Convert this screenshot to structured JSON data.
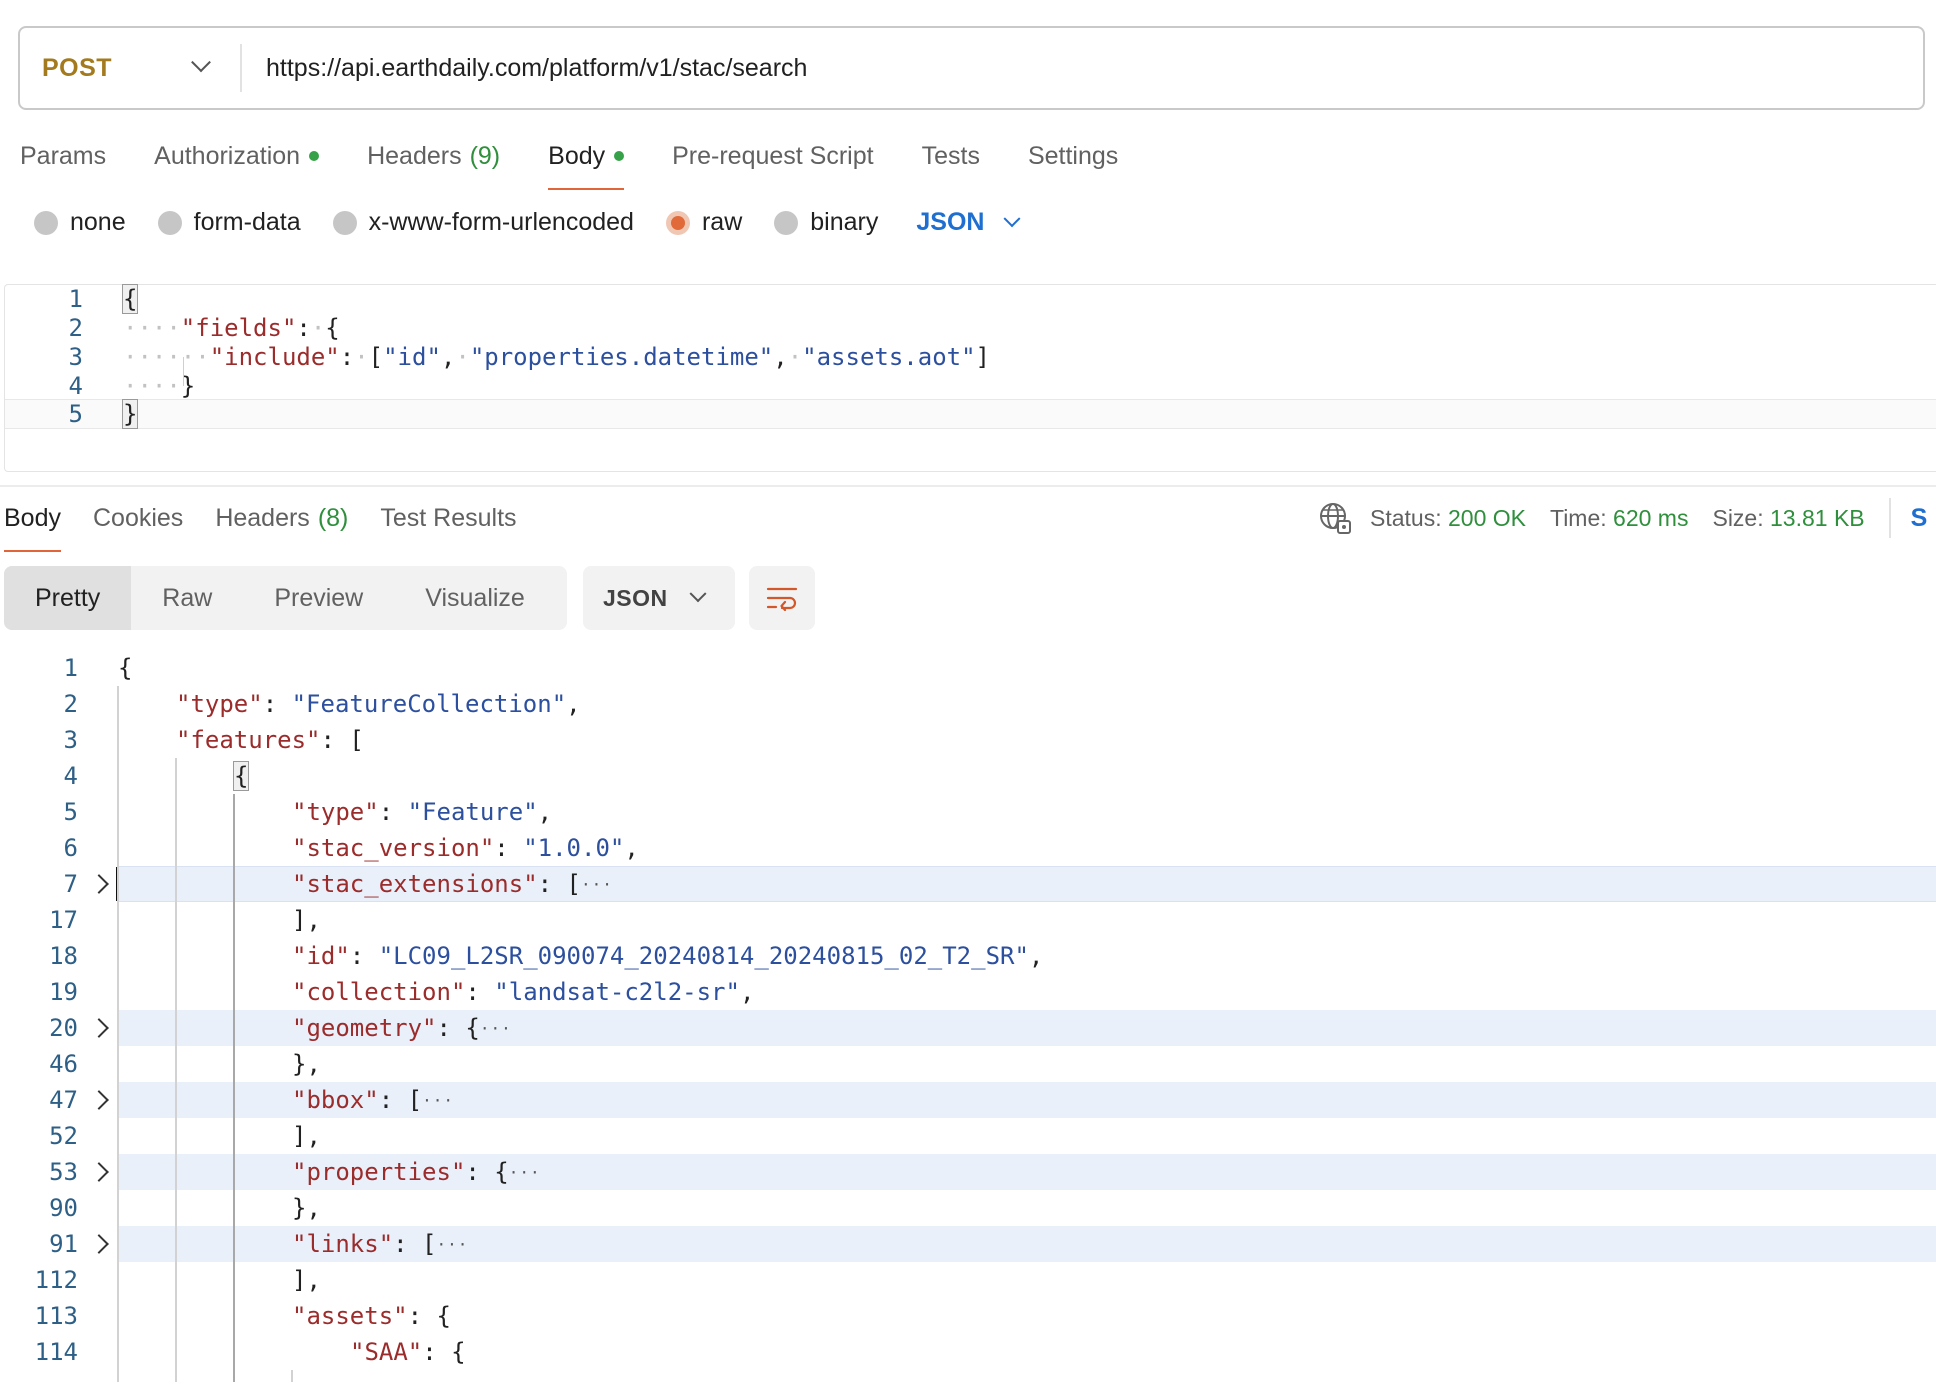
{
  "request": {
    "method": "POST",
    "url": "https://api.earthdaily.com/platform/v1/stac/search"
  },
  "request_tabs": [
    {
      "label": "Params",
      "count": "",
      "dot": false,
      "active": false
    },
    {
      "label": "Authorization",
      "count": "",
      "dot": true,
      "active": false
    },
    {
      "label": "Headers",
      "count": "(9)",
      "dot": false,
      "active": false
    },
    {
      "label": "Body",
      "count": "",
      "dot": true,
      "active": true
    },
    {
      "label": "Pre-request Script",
      "count": "",
      "dot": false,
      "active": false
    },
    {
      "label": "Tests",
      "count": "",
      "dot": false,
      "active": false
    },
    {
      "label": "Settings",
      "count": "",
      "dot": false,
      "active": false
    }
  ],
  "body_types": [
    {
      "label": "none",
      "selected": false
    },
    {
      "label": "form-data",
      "selected": false
    },
    {
      "label": "x-www-form-urlencoded",
      "selected": false
    },
    {
      "label": "raw",
      "selected": true
    },
    {
      "label": "binary",
      "selected": false
    }
  ],
  "body_format": "JSON",
  "request_body_lines": [
    {
      "n": "1",
      "tokens": [
        {
          "t": "{",
          "c": "p"
        }
      ]
    },
    {
      "n": "2",
      "tokens": [
        {
          "t": "····",
          "c": "ws"
        },
        {
          "t": "\"fields\"",
          "c": "k"
        },
        {
          "t": ":",
          "c": "p"
        },
        {
          "t": "·",
          "c": "ws"
        },
        {
          "t": "{",
          "c": "p"
        }
      ]
    },
    {
      "n": "3",
      "tokens": [
        {
          "t": "····",
          "c": "ws"
        },
        {
          "t": "··",
          "c": "ws"
        },
        {
          "t": "\"include\"",
          "c": "k"
        },
        {
          "t": ":",
          "c": "p"
        },
        {
          "t": "·",
          "c": "ws"
        },
        {
          "t": "[",
          "c": "p"
        },
        {
          "t": "\"id\"",
          "c": "s"
        },
        {
          "t": ",",
          "c": "p"
        },
        {
          "t": "·",
          "c": "ws"
        },
        {
          "t": "\"properties.datetime\"",
          "c": "s"
        },
        {
          "t": ",",
          "c": "p"
        },
        {
          "t": "·",
          "c": "ws"
        },
        {
          "t": "\"assets.aot\"",
          "c": "s"
        },
        {
          "t": "]",
          "c": "p"
        }
      ]
    },
    {
      "n": "4",
      "tokens": [
        {
          "t": "····",
          "c": "ws"
        },
        {
          "t": "}",
          "c": "p"
        }
      ]
    },
    {
      "n": "5",
      "tokens": [
        {
          "t": "}",
          "c": "p"
        }
      ]
    }
  ],
  "response_tabs": [
    {
      "label": "Body",
      "count": "",
      "active": true
    },
    {
      "label": "Cookies",
      "count": "",
      "active": false
    },
    {
      "label": "Headers",
      "count": "(8)",
      "active": false
    },
    {
      "label": "Test Results",
      "count": "",
      "active": false
    }
  ],
  "response_status": {
    "status_label": "Status:",
    "status_value": "200 OK",
    "time_label": "Time:",
    "time_value": "620 ms",
    "size_label": "Size:",
    "size_value": "13.81 KB",
    "save_label": "S"
  },
  "view_modes": [
    "Pretty",
    "Raw",
    "Preview",
    "Visualize"
  ],
  "active_view_mode": "Pretty",
  "response_format": "JSON",
  "icons": {
    "globe": "globe-network-icon",
    "wrap": "word-wrap-icon",
    "fold": "chevron-right-icon"
  },
  "colors": {
    "method": "#a37a1e",
    "accent": "#e0663a",
    "success": "#2f8f3d",
    "link": "#1f6fd1",
    "json_key": "#9b2c2c",
    "json_string": "#2c4f9e"
  },
  "response_body_lines": [
    {
      "n": "1",
      "indent": 0,
      "tokens": [
        {
          "t": "{",
          "c": "p"
        }
      ]
    },
    {
      "n": "2",
      "indent": 1,
      "tokens": [
        {
          "t": "\"type\"",
          "c": "k"
        },
        {
          "t": ": ",
          "c": "p"
        },
        {
          "t": "\"FeatureCollection\"",
          "c": "s"
        },
        {
          "t": ",",
          "c": "p"
        }
      ]
    },
    {
      "n": "3",
      "indent": 1,
      "tokens": [
        {
          "t": "\"features\"",
          "c": "k"
        },
        {
          "t": ": [",
          "c": "p"
        }
      ]
    },
    {
      "n": "4",
      "indent": 2,
      "tokens": [
        {
          "t": "{",
          "c": "p",
          "box": true
        }
      ]
    },
    {
      "n": "5",
      "indent": 3,
      "tokens": [
        {
          "t": "\"type\"",
          "c": "k"
        },
        {
          "t": ": ",
          "c": "p"
        },
        {
          "t": "\"Feature\"",
          "c": "s"
        },
        {
          "t": ",",
          "c": "p"
        }
      ]
    },
    {
      "n": "6",
      "indent": 3,
      "tokens": [
        {
          "t": "\"stac_version\"",
          "c": "k"
        },
        {
          "t": ": ",
          "c": "p"
        },
        {
          "t": "\"1.0.0\"",
          "c": "s"
        },
        {
          "t": ",",
          "c": "p"
        }
      ]
    },
    {
      "n": "7",
      "indent": 3,
      "fold": true,
      "hl": true,
      "cursor": true,
      "tokens": [
        {
          "t": "\"stac_extensions\"",
          "c": "k"
        },
        {
          "t": ": [",
          "c": "p"
        },
        {
          "t": "···",
          "c": "ell"
        }
      ]
    },
    {
      "n": "17",
      "indent": 3,
      "tokens": [
        {
          "t": "],",
          "c": "p"
        }
      ]
    },
    {
      "n": "18",
      "indent": 3,
      "tokens": [
        {
          "t": "\"id\"",
          "c": "k"
        },
        {
          "t": ": ",
          "c": "p"
        },
        {
          "t": "\"LC09_L2SR_090074_20240814_20240815_02_T2_SR\"",
          "c": "s"
        },
        {
          "t": ",",
          "c": "p"
        }
      ]
    },
    {
      "n": "19",
      "indent": 3,
      "tokens": [
        {
          "t": "\"collection\"",
          "c": "k"
        },
        {
          "t": ": ",
          "c": "p"
        },
        {
          "t": "\"landsat-c2l2-sr\"",
          "c": "s"
        },
        {
          "t": ",",
          "c": "p"
        }
      ]
    },
    {
      "n": "20",
      "indent": 3,
      "fold": true,
      "hl": true,
      "tokens": [
        {
          "t": "\"geometry\"",
          "c": "k"
        },
        {
          "t": ": {",
          "c": "p"
        },
        {
          "t": "···",
          "c": "ell"
        }
      ]
    },
    {
      "n": "46",
      "indent": 3,
      "tokens": [
        {
          "t": "},",
          "c": "p"
        }
      ]
    },
    {
      "n": "47",
      "indent": 3,
      "fold": true,
      "hl": true,
      "tokens": [
        {
          "t": "\"bbox\"",
          "c": "k"
        },
        {
          "t": ": [",
          "c": "p"
        },
        {
          "t": "···",
          "c": "ell"
        }
      ]
    },
    {
      "n": "52",
      "indent": 3,
      "tokens": [
        {
          "t": "],",
          "c": "p"
        }
      ]
    },
    {
      "n": "53",
      "indent": 3,
      "fold": true,
      "hl": true,
      "tokens": [
        {
          "t": "\"properties\"",
          "c": "k"
        },
        {
          "t": ": {",
          "c": "p"
        },
        {
          "t": "···",
          "c": "ell"
        }
      ]
    },
    {
      "n": "90",
      "indent": 3,
      "tokens": [
        {
          "t": "},",
          "c": "p"
        }
      ]
    },
    {
      "n": "91",
      "indent": 3,
      "fold": true,
      "hl": true,
      "tokens": [
        {
          "t": "\"links\"",
          "c": "k"
        },
        {
          "t": ": [",
          "c": "p"
        },
        {
          "t": "···",
          "c": "ell"
        }
      ]
    },
    {
      "n": "112",
      "indent": 3,
      "tokens": [
        {
          "t": "],",
          "c": "p"
        }
      ]
    },
    {
      "n": "113",
      "indent": 3,
      "tokens": [
        {
          "t": "\"assets\"",
          "c": "k"
        },
        {
          "t": ": {",
          "c": "p"
        }
      ]
    },
    {
      "n": "114",
      "indent": 4,
      "tokens": [
        {
          "t": "\"SAA\"",
          "c": "k"
        },
        {
          "t": ": {",
          "c": "p"
        }
      ]
    }
  ]
}
